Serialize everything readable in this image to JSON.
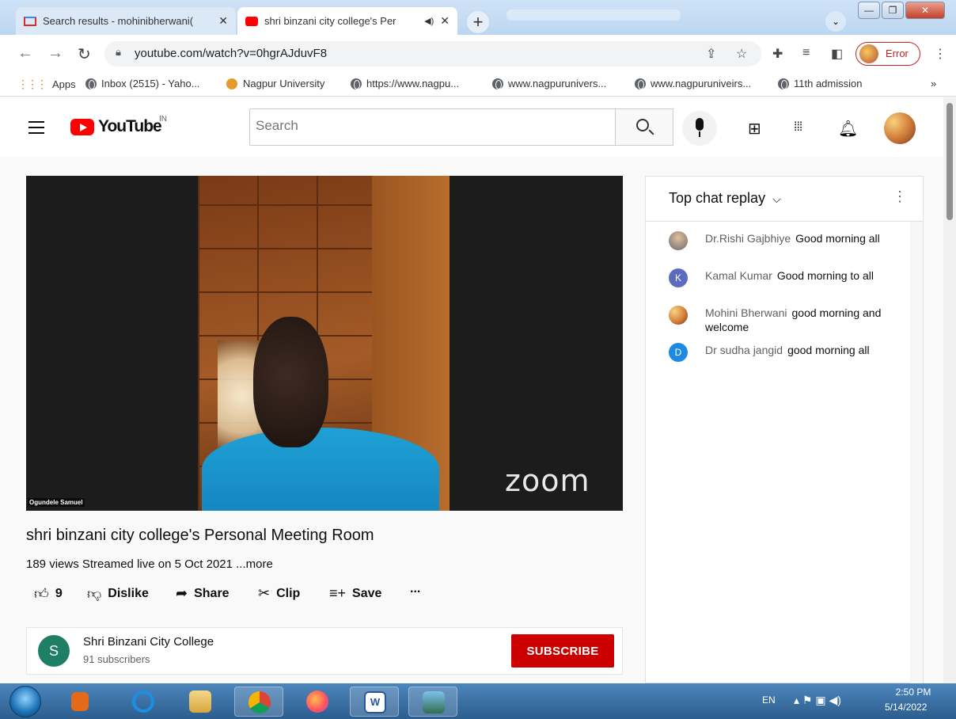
{
  "browser": {
    "tabs": [
      {
        "title": "Search results - mohinibherwani(",
        "active": false
      },
      {
        "title": "shri binzani city college's Per",
        "active": true
      }
    ],
    "url": "youtube.com/watch?v=0hgrAJduvF8",
    "profile_status": "Error",
    "bookmarks": [
      "Apps",
      "Inbox (2515) - Yaho...",
      "Nagpur University",
      "https://www.nagpu...",
      "www.nagpurunivers...",
      "www.nagpuruniveirs...",
      "11th admission"
    ],
    "overflow": "»"
  },
  "youtube": {
    "logo_text": "YouTube",
    "country_code": "IN",
    "search_placeholder": "Search"
  },
  "video": {
    "participant_name": "Ogundele Samuel",
    "watermark": "zoom",
    "title": "shri binzani city college's Personal Meeting Room",
    "views_line": "189 views  Streamed live on 5 Oct 2021 ...more",
    "actions": {
      "likes": "9",
      "dislike": "Dislike",
      "share": "Share",
      "clip": "Clip",
      "save": "Save",
      "more": "..."
    }
  },
  "channel": {
    "avatar_letter": "S",
    "name": "Shri Binzani City College",
    "subscribers": "91 subscribers",
    "subscribe_label": "SUBSCRIBE"
  },
  "chat": {
    "header": "Top chat replay",
    "messages": [
      {
        "author": "Dr.Rishi Gajbhiye",
        "text": "Good morning all",
        "avatar_letter": "",
        "avatar_color": "#8a8a8a"
      },
      {
        "author": "Kamal Kumar",
        "text": "Good morning to all",
        "avatar_letter": "K",
        "avatar_color": "#5c6bc0"
      },
      {
        "author": "Mohini Bherwani",
        "text": "good morning and welcome",
        "avatar_letter": "",
        "avatar_color": "#d4803b"
      },
      {
        "author": "Dr sudha jangid",
        "text": "good morning all",
        "avatar_letter": "D",
        "avatar_color": "#1e88e5"
      }
    ]
  },
  "taskbar": {
    "language": "EN",
    "time": "2:50 PM",
    "date": "5/14/2022"
  },
  "colors": {
    "youtube_red": "#ff0000",
    "subscribe_red": "#cc0000",
    "chrome_error_red": "#c5221f"
  }
}
